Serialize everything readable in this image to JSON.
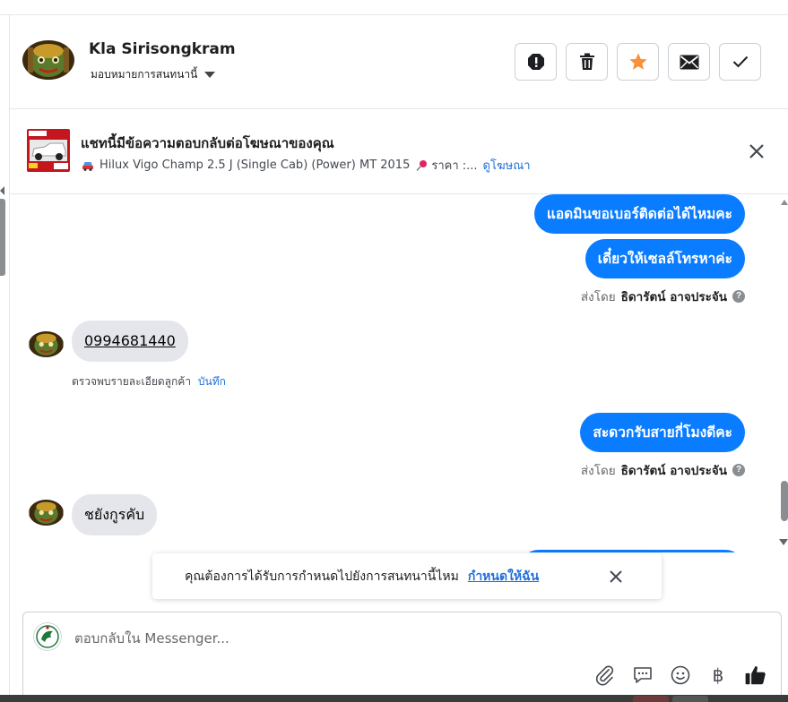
{
  "header": {
    "contact_name": "Kla Sirisongkram",
    "assign_label": "มอบหมายการสนทนานี้",
    "actions": [
      {
        "name": "mark-spam-button",
        "icon": "exclamation-octagon-icon"
      },
      {
        "name": "delete-button",
        "icon": "trash-icon"
      },
      {
        "name": "star-button",
        "icon": "star-icon"
      },
      {
        "name": "mark-unread-button",
        "icon": "envelope-icon"
      },
      {
        "name": "mark-done-button",
        "icon": "checkmark-icon"
      }
    ]
  },
  "ad_banner": {
    "title": "แชทนี้มีข้อความตอบกลับต่อโฆษณาของคุณ",
    "car_name": "Hilux Vigo Champ 2.5 J (Single Cab) (Power) MT 2015",
    "price_label": "ราคา :...",
    "view_ad_link": "ดูโฆษณา"
  },
  "messages": {
    "out_1": "แอดมินขอเบอร์ติดต่อได้ไหมคะ",
    "out_2": "เดี๋ยวให้เซลล์โทรหาค่ะ",
    "sent_by_1": {
      "prefix": "ส่งโดย",
      "name": "ธิดารัตน์ อาจประจัน"
    },
    "in_phone": "0994681440",
    "customer_hint": {
      "text": "ตรวจพบรายละเอียดลูกค้า",
      "link": "บันทึก"
    },
    "out_3": "สะดวกรับสายกี่โมงดีคะ",
    "sent_by_2": {
      "prefix": "ส่งโดย",
      "name": "ธิดารัตน์ อาจประจัน"
    },
    "in_2": "ชยังกูรคับ"
  },
  "toast": {
    "text": "คุณต้องการได้รับการกำหนดไปยังการสนทนานี้ไหม",
    "link": "กำหนดให้ฉัน"
  },
  "composer": {
    "placeholder": "ตอบกลับใน Messenger...",
    "tools": [
      "attachment-icon",
      "saved-replies-icon",
      "emoji-icon",
      "baht-icon",
      "thumbs-up-icon"
    ],
    "baht_symbol": "฿"
  },
  "colors": {
    "accent": "#0a7cff",
    "link": "#216fdb",
    "star": "#f7923b",
    "incoming_bubble": "#e4e6eb"
  }
}
